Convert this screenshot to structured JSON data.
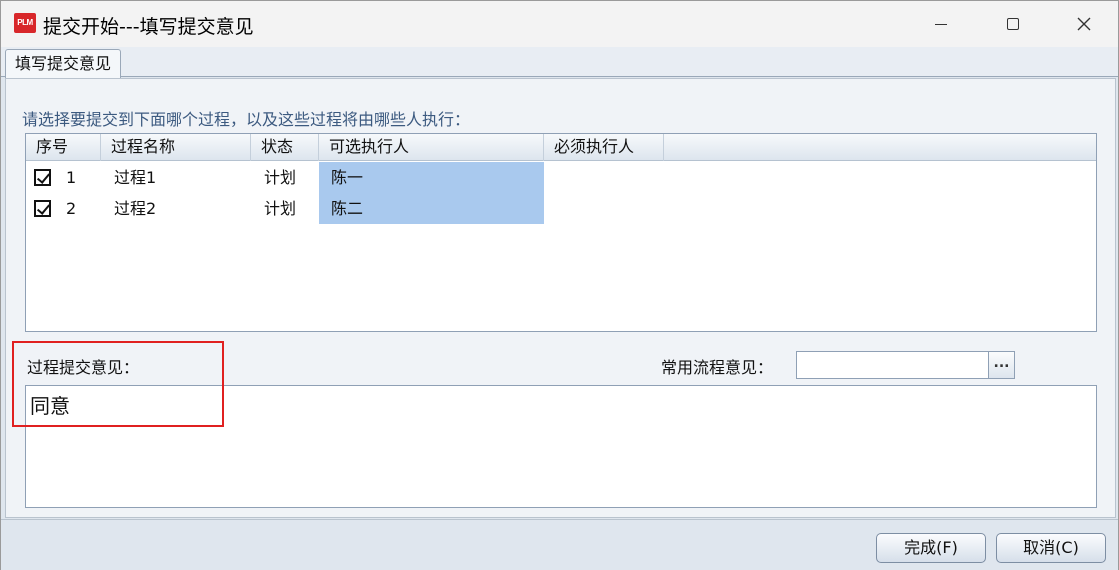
{
  "window": {
    "title": "提交开始---填写提交意见",
    "app_icon_text": "PLM",
    "icons": [
      "minimize-icon",
      "maximize-icon",
      "close-icon"
    ]
  },
  "tabs": [
    {
      "label": "填写提交意见",
      "active": true
    }
  ],
  "prompt": "请选择要提交到下面哪个过程，以及这些过程将由哪些人执行：",
  "table": {
    "columns": [
      "序号",
      "过程名称",
      "状态",
      "可选执行人",
      "必须执行人"
    ],
    "rows": [
      {
        "checked": true,
        "num": "1",
        "name": "过程1",
        "status": "计划",
        "optional_exec": "陈一",
        "required_exec": ""
      },
      {
        "checked": true,
        "num": "2",
        "name": "过程2",
        "status": "计划",
        "optional_exec": "陈二",
        "required_exec": ""
      }
    ]
  },
  "opinion": {
    "label": "过程提交意见：",
    "value": "同意"
  },
  "common": {
    "label": "常用流程意见：",
    "value": "",
    "button_label": "..."
  },
  "buttons": {
    "finish": "完成(F)",
    "cancel": "取消(C)"
  },
  "colors": {
    "selection": "#a9c9ee",
    "highlight": "#e02020",
    "prompt": "#3c5a80"
  }
}
